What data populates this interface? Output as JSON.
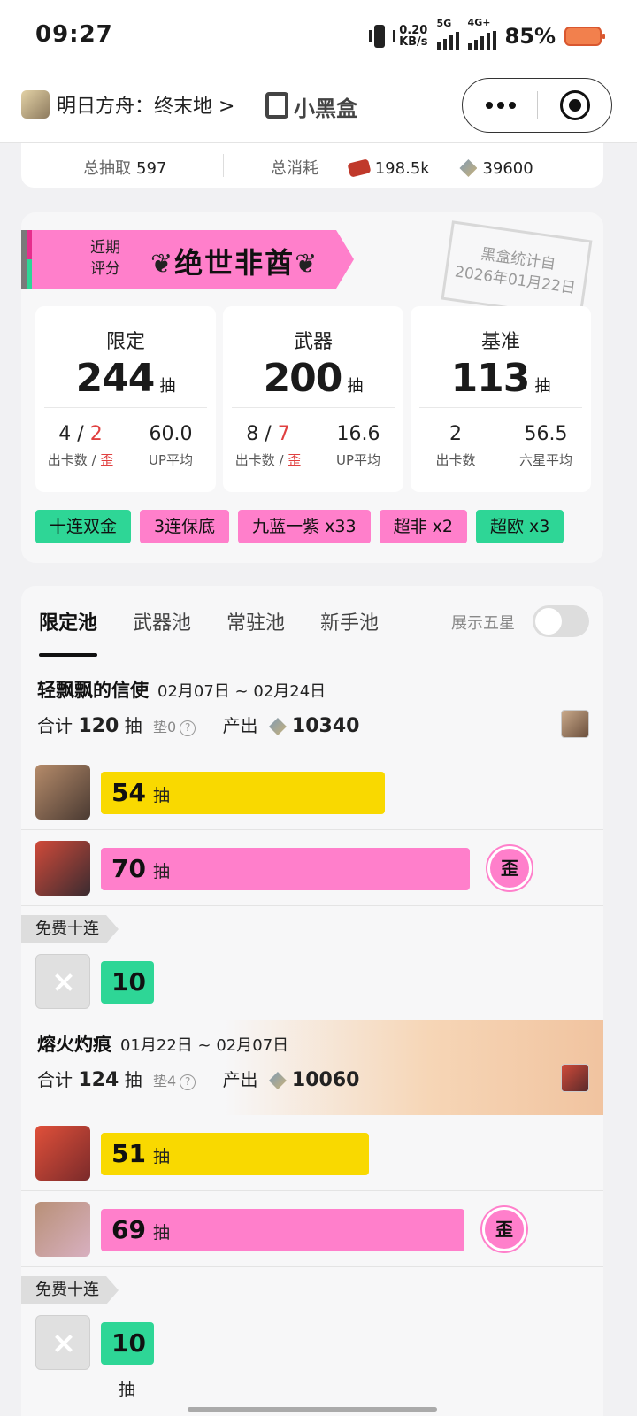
{
  "status_bar": {
    "time": "09:27",
    "net_speed_top": "0.20",
    "net_speed_bottom": "KB/s",
    "sim1": "5G",
    "sim2": "4G+",
    "battery": "85%"
  },
  "header": {
    "game_name": "明日方舟：终末地 >",
    "app_name": "小黑盒",
    "capsule_more": "more-icon",
    "capsule_record": "record-icon"
  },
  "totals": {
    "draw_label": "总抽取",
    "draw_value": "597",
    "cost_label": "总消耗",
    "ticket_value": "198.5k",
    "originium_value": "39600"
  },
  "rating": {
    "label": "近期评分",
    "value": "绝世非酋",
    "stamp_line1": "黑盒统计自",
    "stamp_line2": "2026年01月22日"
  },
  "stats": [
    {
      "title": "限定",
      "count": "244",
      "unit": "抽",
      "left_value_a": "4",
      "left_value_sep": " / ",
      "left_value_b": "2",
      "left_key_a": "出卡数 / ",
      "left_key_b": "歪",
      "right_value": "60.0",
      "right_key": "UP平均"
    },
    {
      "title": "武器",
      "count": "200",
      "unit": "抽",
      "left_value_a": "8",
      "left_value_sep": " / ",
      "left_value_b": "7",
      "left_key_a": "出卡数 / ",
      "left_key_b": "歪",
      "right_value": "16.6",
      "right_key": "UP平均"
    },
    {
      "title": "基准",
      "count": "113",
      "unit": "抽",
      "left_value_a": "2",
      "left_value_sep": "",
      "left_value_b": "",
      "left_key_a": "出卡数",
      "left_key_b": "",
      "right_value": "56.5",
      "right_key": "六星平均"
    }
  ],
  "tags": [
    {
      "label": "十连双金",
      "color": "green"
    },
    {
      "label": "3连保底",
      "color": "pink"
    },
    {
      "label": "九蓝一紫 x33",
      "color": "pink"
    },
    {
      "label": "超非 x2",
      "color": "pink"
    },
    {
      "label": "超欧 x3",
      "color": "green"
    }
  ],
  "tabs": [
    "限定池",
    "武器池",
    "常驻池",
    "新手池"
  ],
  "five_star_label": "展示五星",
  "banners": [
    {
      "name": "轻飘飘的信使",
      "dates": "02月07日 ~ 02月24日",
      "total_prefix": "合计",
      "total": "120",
      "unit": "抽",
      "pad": "垫0",
      "output_label": "产出",
      "output": "10340",
      "pulls": [
        {
          "count": "54",
          "unit": "抽",
          "fill": 0.54,
          "color": "yellow",
          "off_banner": false
        },
        {
          "count": "70",
          "unit": "抽",
          "fill": 0.7,
          "color": "pink",
          "off_banner": true,
          "off_label": "歪"
        }
      ],
      "free_label": "免费十连",
      "free_count": "10",
      "free_fill": 0.1
    },
    {
      "name": "熔火灼痕",
      "dates": "01月22日 ~ 02月07日",
      "total_prefix": "合计",
      "total": "124",
      "unit": "抽",
      "pad": "垫4",
      "output_label": "产出",
      "output": "10060",
      "pulls": [
        {
          "count": "51",
          "unit": "抽",
          "fill": 0.51,
          "color": "yellow",
          "off_banner": false
        },
        {
          "count": "69",
          "unit": "抽",
          "fill": 0.69,
          "color": "pink",
          "off_banner": true,
          "off_label": "歪"
        }
      ],
      "free_label": "免费十连",
      "free_count": "10",
      "free_fill": 0.1
    }
  ],
  "colors": {
    "pink": "#ff7fcb",
    "green": "#2ed696",
    "yellow": "#f9d900",
    "red": "#e04040"
  }
}
